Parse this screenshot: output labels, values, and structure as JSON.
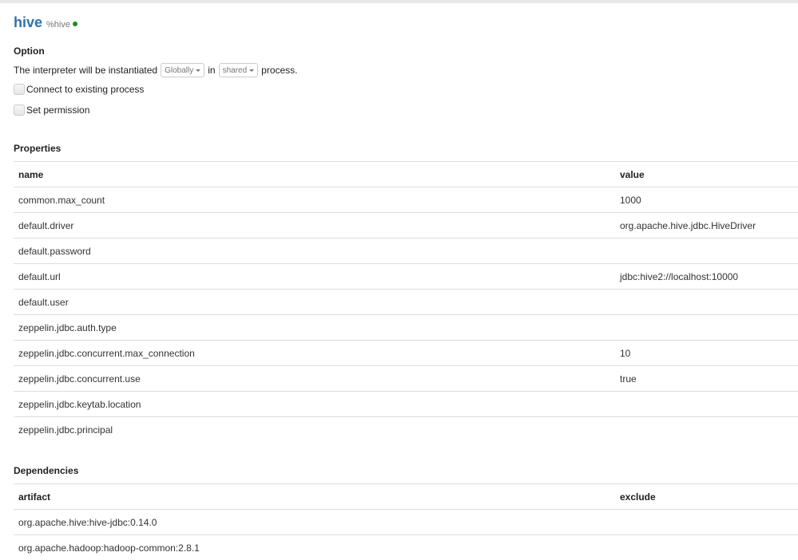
{
  "interpreter": {
    "name": "hive",
    "group": "%hive",
    "status_color": "#1a8f1a"
  },
  "option": {
    "title": "Option",
    "line_prefix": "The interpreter will be instantiated",
    "scope_value": "Globally",
    "line_in": "in",
    "process_value": "shared",
    "line_suffix": "process.",
    "connect_existing_label": "Connect to existing process",
    "set_permission_label": "Set permission"
  },
  "properties": {
    "title": "Properties",
    "headers": {
      "name": "name",
      "value": "value"
    },
    "rows": [
      {
        "name": "common.max_count",
        "value": "1000"
      },
      {
        "name": "default.driver",
        "value": "org.apache.hive.jdbc.HiveDriver"
      },
      {
        "name": "default.password",
        "value": ""
      },
      {
        "name": "default.url",
        "value": "jdbc:hive2://localhost:10000"
      },
      {
        "name": "default.user",
        "value": ""
      },
      {
        "name": "zeppelin.jdbc.auth.type",
        "value": ""
      },
      {
        "name": "zeppelin.jdbc.concurrent.max_connection",
        "value": "10"
      },
      {
        "name": "zeppelin.jdbc.concurrent.use",
        "value": "true"
      },
      {
        "name": "zeppelin.jdbc.keytab.location",
        "value": ""
      },
      {
        "name": "zeppelin.jdbc.principal",
        "value": ""
      }
    ]
  },
  "dependencies": {
    "title": "Dependencies",
    "headers": {
      "artifact": "artifact",
      "exclude": "exclude"
    },
    "rows": [
      {
        "artifact": "org.apache.hive:hive-jdbc:0.14.0",
        "exclude": ""
      },
      {
        "artifact": "org.apache.hadoop:hadoop-common:2.8.1",
        "exclude": ""
      }
    ]
  }
}
